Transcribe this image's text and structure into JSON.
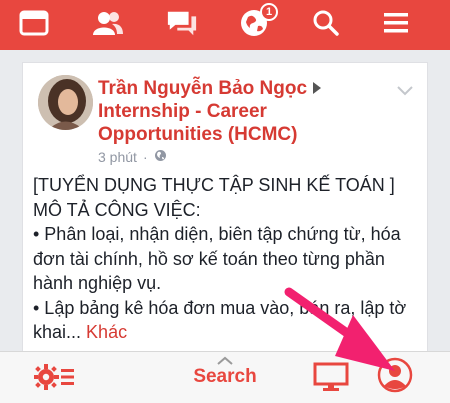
{
  "topbar": {
    "icons": [
      "browser-window-icon",
      "friends-icon",
      "messages-icon",
      "notifications-globe-icon",
      "search-icon",
      "menu-icon"
    ],
    "notification_count": "1"
  },
  "post": {
    "author": "Trần Nguyễn Bảo Ngọc",
    "group": "Internship - Career Opportunities (HCMC)",
    "time": "3 phút",
    "lines": [
      "[TUYỂN DỤNG THỰC TẬP SINH KẾ TOÁN ]",
      "MÔ TẢ CÔNG VIỆC:",
      "• Phân loại, nhận diện, biên tập chứng từ, hóa đơn tài chính, hồ sơ kế toán theo từng phần hành nghiệp vụ.",
      "• Lập bảng kê hóa đơn mua vào, bán ra, lập tờ khai..."
    ],
    "more_label": "Khác"
  },
  "bottombar": {
    "search_label": "Search"
  },
  "colors": {
    "brand_red": "#e8473f",
    "annotation_pink": "#f2216f"
  }
}
